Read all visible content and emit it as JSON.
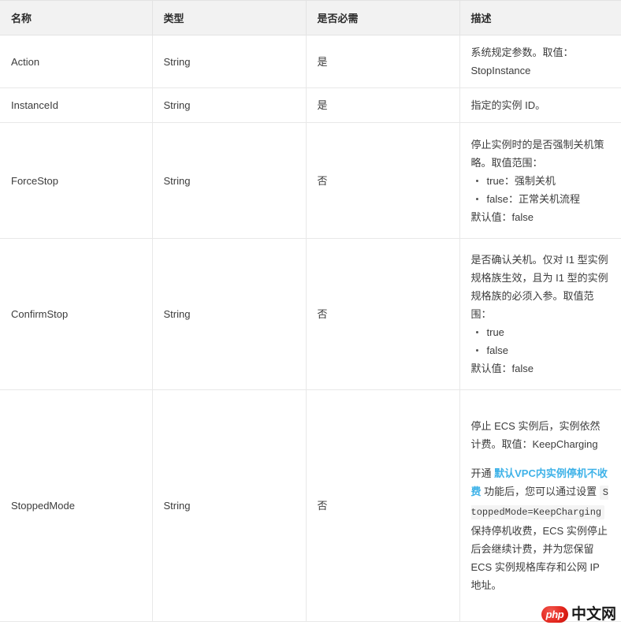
{
  "table": {
    "headers": [
      {
        "label": "名称"
      },
      {
        "label": "类型"
      },
      {
        "label": "是否必需"
      },
      {
        "label": "描述"
      }
    ],
    "rows": [
      {
        "name": "Action",
        "type": "String",
        "required": "是",
        "desc": {
          "p1": "系统规定参数。取值：StopInstance"
        }
      },
      {
        "name": "InstanceId",
        "type": "String",
        "required": "是",
        "desc": {
          "p1": "指定的实例 ID。"
        }
      },
      {
        "name": "ForceStop",
        "type": "String",
        "required": "否",
        "desc": {
          "p1": "停止实例时的是否强制关机策略。取值范围：",
          "items": [
            "true：强制关机",
            "false：正常关机流程"
          ],
          "p2": "默认值：false"
        }
      },
      {
        "name": "ConfirmStop",
        "type": "String",
        "required": "否",
        "desc": {
          "p1": "是否确认关机。仅对 I1 型实例规格族生效，且为 I1 型的实例规格族的必须入参。取值范围：",
          "items": [
            "true",
            "false"
          ],
          "p2": "默认值：false"
        }
      },
      {
        "name": "StoppedMode",
        "type": "String",
        "required": "否",
        "desc": {
          "p1": "停止 ECS 实例后，实例依然计费。取值：KeepCharging",
          "p2_before_link": "开通 ",
          "link_text": "默认VPC内实例停机不收费",
          "p2_after_link": " 功能后，您可以通过设置 ",
          "code": "StoppedMode=KeepCharging",
          "p2_after_code": " 保持停机收费，ECS 实例停止后会继续计费，并为您保留 ECS 实例规格库存和公网 IP 地址。"
        }
      }
    ]
  },
  "watermark": {
    "badge": "php",
    "text": "中文网"
  },
  "colors": {
    "link": "#3eb2e8",
    "header_bg": "#f2f2f2",
    "border": "#e8e8e8",
    "code_bg": "#f4f4f4",
    "text": "#3c3c3c",
    "watermark_red": "#e2231a"
  }
}
